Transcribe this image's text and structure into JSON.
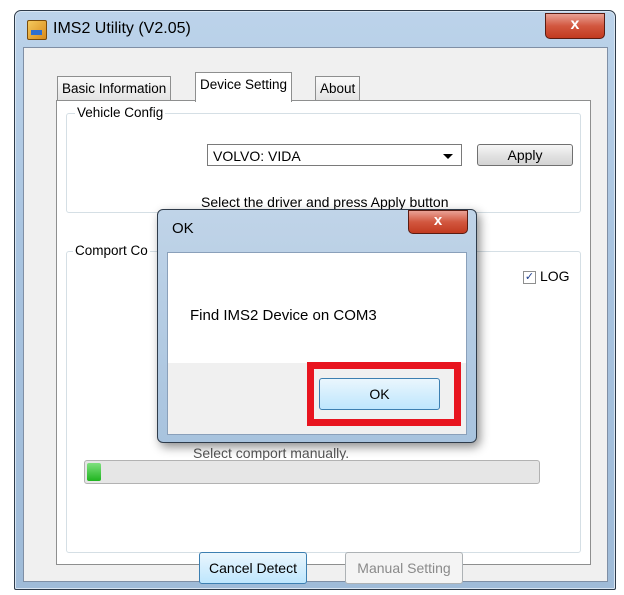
{
  "window": {
    "title": "IMS2 Utility (V2.05)",
    "close_glyph": "x"
  },
  "tabs": [
    {
      "label": "Basic Information"
    },
    {
      "label": "Device Setting"
    },
    {
      "label": "About"
    }
  ],
  "vehicle_config": {
    "group_label": "Vehicle Config",
    "driver_selected": "VOLVO: VIDA",
    "apply_label": "Apply",
    "hint": "Select the driver and press Apply button"
  },
  "comport_config": {
    "group_label": "Comport Co",
    "log_label": "LOG",
    "log_checked": true,
    "obscured_text": "Select comport manually.",
    "progress_fraction": 0.03,
    "cancel_detect_label": "Cancel Detect",
    "manual_setting_label": "Manual Setting"
  },
  "dialog": {
    "title": "OK",
    "close_glyph": "x",
    "message": "Find IMS2 Device on COM3",
    "ok_label": "OK",
    "highlight_color": "#e8141f"
  },
  "colors": {
    "accent": "#3c7fb1",
    "close_red": "#c23a20"
  }
}
